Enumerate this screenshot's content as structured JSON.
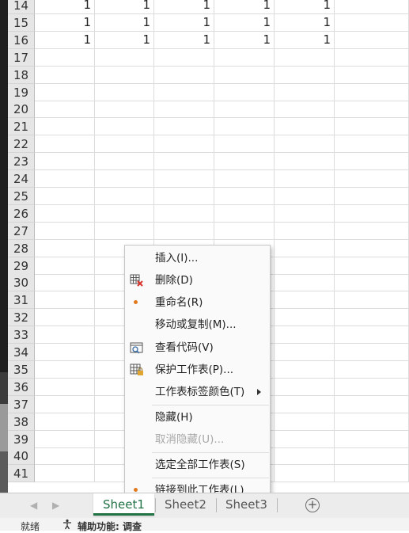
{
  "grid": {
    "rows": [
      {
        "num": "14",
        "values": [
          "1",
          "1",
          "1",
          "1",
          "1"
        ]
      },
      {
        "num": "15",
        "values": [
          "1",
          "1",
          "1",
          "1",
          "1"
        ]
      },
      {
        "num": "16",
        "values": [
          "1",
          "1",
          "1",
          "1",
          "1"
        ]
      },
      {
        "num": "17",
        "values": [
          "",
          "",
          "",
          "",
          ""
        ]
      },
      {
        "num": "18",
        "values": [
          "",
          "",
          "",
          "",
          ""
        ]
      },
      {
        "num": "19",
        "values": [
          "",
          "",
          "",
          "",
          ""
        ]
      },
      {
        "num": "20",
        "values": [
          "",
          "",
          "",
          "",
          ""
        ]
      },
      {
        "num": "21",
        "values": [
          "",
          "",
          "",
          "",
          ""
        ]
      },
      {
        "num": "22",
        "values": [
          "",
          "",
          "",
          "",
          ""
        ]
      },
      {
        "num": "23",
        "values": [
          "",
          "",
          "",
          "",
          ""
        ]
      },
      {
        "num": "24",
        "values": [
          "",
          "",
          "",
          "",
          ""
        ]
      },
      {
        "num": "25",
        "values": [
          "",
          "",
          "",
          "",
          ""
        ]
      },
      {
        "num": "26",
        "values": [
          "",
          "",
          "",
          "",
          ""
        ]
      },
      {
        "num": "27",
        "values": [
          "",
          "",
          "",
          "",
          ""
        ]
      },
      {
        "num": "28",
        "values": [
          "",
          "",
          "",
          "",
          ""
        ]
      },
      {
        "num": "29",
        "values": [
          "",
          "",
          "",
          "",
          ""
        ]
      },
      {
        "num": "30",
        "values": [
          "",
          "",
          "",
          "",
          ""
        ]
      },
      {
        "num": "31",
        "values": [
          "",
          "",
          "",
          "",
          ""
        ]
      },
      {
        "num": "32",
        "values": [
          "",
          "",
          "",
          "",
          ""
        ]
      },
      {
        "num": "33",
        "values": [
          "",
          "",
          "",
          "",
          ""
        ]
      },
      {
        "num": "34",
        "values": [
          "",
          "",
          "",
          "",
          ""
        ]
      },
      {
        "num": "35",
        "values": [
          "",
          "",
          "",
          "",
          ""
        ]
      },
      {
        "num": "36",
        "values": [
          "",
          "",
          "",
          "",
          ""
        ]
      },
      {
        "num": "37",
        "values": [
          "",
          "",
          "",
          "",
          ""
        ]
      },
      {
        "num": "38",
        "values": [
          "",
          "",
          "",
          "",
          ""
        ]
      },
      {
        "num": "39",
        "values": [
          "",
          "",
          "",
          "",
          ""
        ]
      },
      {
        "num": "40",
        "values": [
          "",
          "",
          "",
          "",
          ""
        ]
      },
      {
        "num": "41",
        "values": [
          "",
          "",
          "",
          "",
          ""
        ]
      }
    ]
  },
  "context_menu": {
    "insert": "插入(I)...",
    "delete": "删除(D)",
    "rename": "重命名(R)",
    "move_copy": "移动或复制(M)...",
    "view_code": "查看代码(V)",
    "protect_sheet": "保护工作表(P)...",
    "tab_color": "工作表标签颜色(T)",
    "hide": "隐藏(H)",
    "unhide": "取消隐藏(U)...",
    "select_all_sheets": "选定全部工作表(S)",
    "link_to_sheet": "链接到此工作表(L)"
  },
  "tabs": {
    "items": [
      "Sheet1",
      "Sheet2",
      "Sheet3"
    ],
    "active": "Sheet1",
    "add_icon": "plus-circle-icon"
  },
  "status_bar": {
    "ready": "就绪",
    "accessibility": "辅助功能: 调查"
  },
  "colors": {
    "accent": "#217346",
    "menu_dot": "#e07a1f"
  }
}
